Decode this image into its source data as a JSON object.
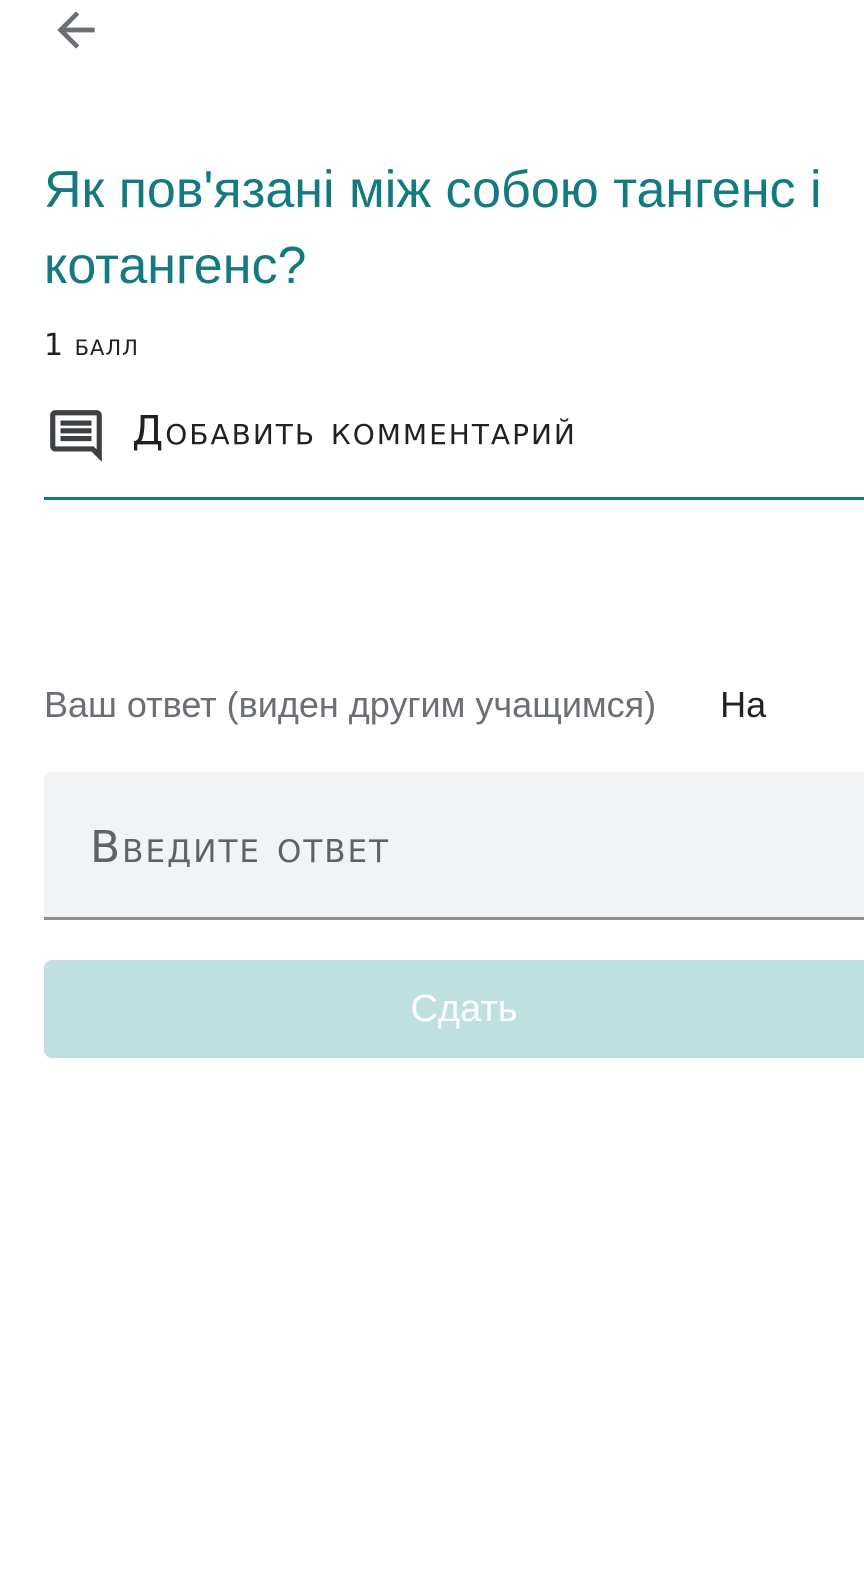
{
  "header": {
    "back_icon": "arrow-back-icon"
  },
  "question": {
    "title": "Як пов'язані між собою тангенс і котангенс?",
    "points": "1 балл"
  },
  "comment": {
    "icon": "comment-icon",
    "label": "Добавить комментарий"
  },
  "answer": {
    "label": "Ваш ответ (виден другим учащимся)",
    "extra": "На",
    "placeholder": "Введите ответ",
    "value": ""
  },
  "submit": {
    "label": "Сдать",
    "disabled": true
  },
  "colors": {
    "accent": "#137a7f",
    "submit_disabled_bg": "#bfdfe0",
    "input_bg": "#f1f3f4",
    "secondary_text": "#6b6f73"
  }
}
